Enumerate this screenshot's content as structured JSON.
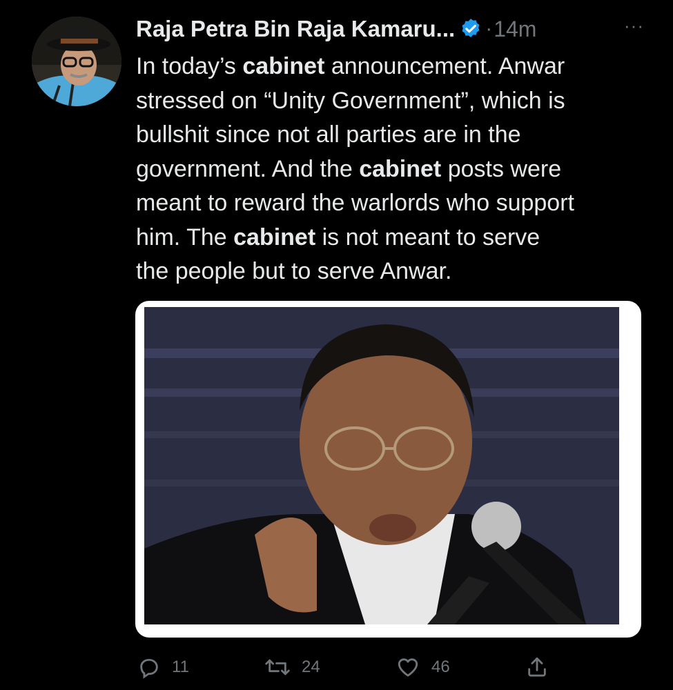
{
  "tweet": {
    "author_name": "Raja Petra Bin Raja Kamaru...",
    "separator": "·",
    "timestamp": "14m",
    "more_label": "···",
    "body": {
      "line1_pre": "In today’s ",
      "line1_bold": "cabinet",
      "line1_post": " announcement. Anwar",
      "line2": "stressed on “Unity Government”, which is",
      "line3": "bullshit since not all parties are in the",
      "line4_pre": "government. And the ",
      "line4_bold": "cabinet",
      "line4_post": " posts were",
      "line5": "meant to reward the warlords who support",
      "line6_pre": "him. The ",
      "line6_bold": "cabinet",
      "line6_post": " is not meant to serve",
      "line7": "the people but to serve Anwar."
    }
  },
  "actions": {
    "replies": "11",
    "retweets": "24",
    "likes": "46"
  },
  "icons": {
    "verified": "verified-badge-icon",
    "reply": "reply-icon",
    "retweet": "retweet-icon",
    "like": "heart-icon",
    "share": "share-icon"
  },
  "colors": {
    "background": "#000000",
    "text": "#e7e9ea",
    "muted": "#71767b",
    "verified": "#1d9bf0"
  }
}
